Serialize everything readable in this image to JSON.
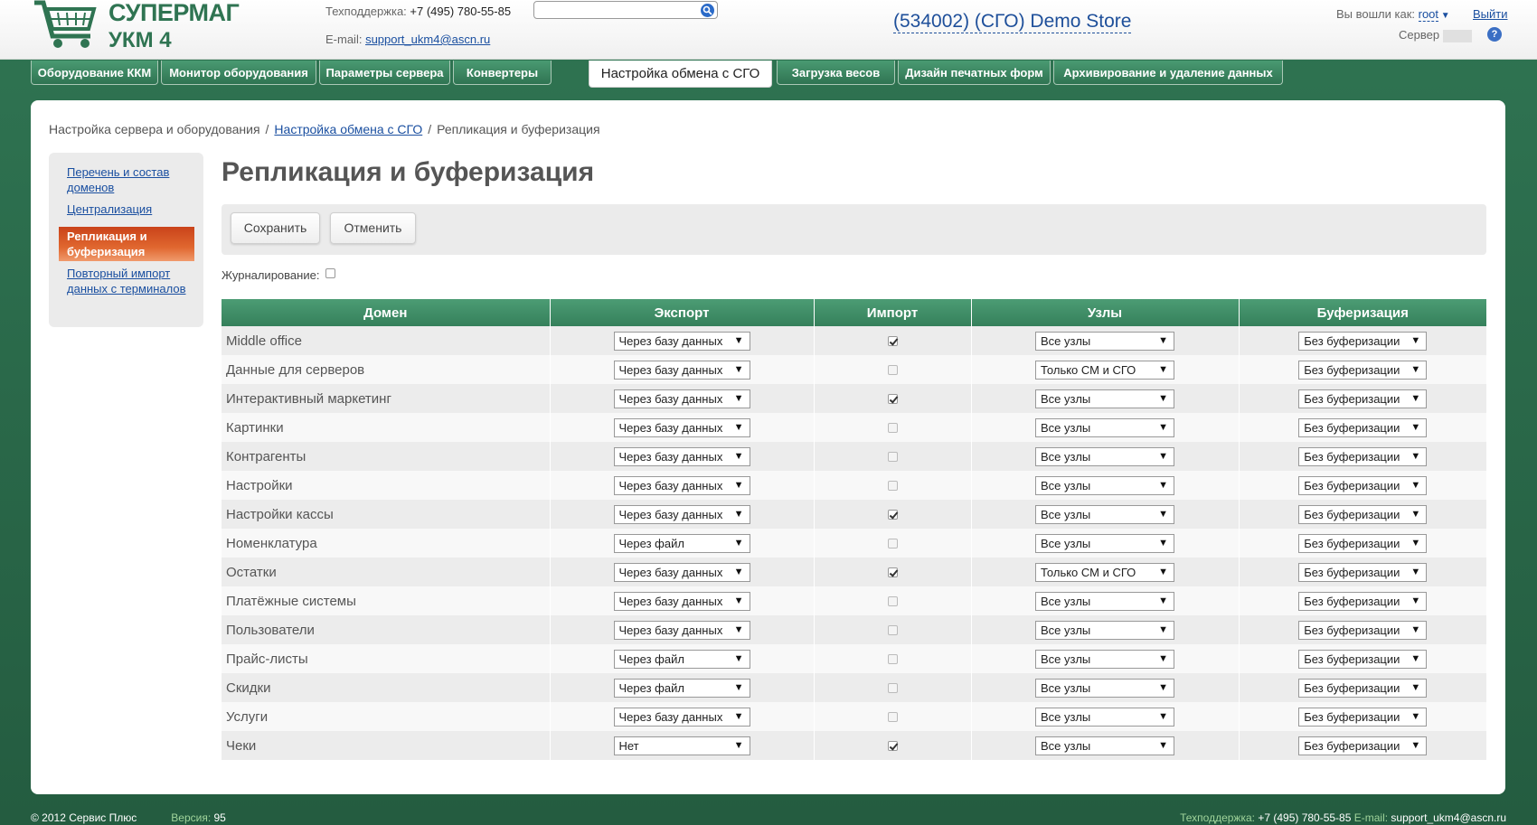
{
  "header": {
    "logo_line1": "СУПЕРМАГ",
    "logo_line2": "УКМ 4",
    "support_label": "Техподдержка: ",
    "support_phone": "+7 (495) 780-55-85",
    "email_label": "E-mail: ",
    "email": "support_ukm4@ascn.ru",
    "search_placeholder": "",
    "store_name": "(534002) (СГО) Demo Store",
    "logged_in_label": "Вы вошли как: ",
    "username": "root",
    "logout_label": "Выйти",
    "server_label": "Сервер",
    "help_glyph": "?"
  },
  "tabs": [
    {
      "label": "Оборудование ККМ"
    },
    {
      "label": "Монитор оборудования"
    },
    {
      "label": "Параметры сервера"
    },
    {
      "label": "Конвертеры"
    },
    {
      "label": "Настройка обмена с СГО",
      "active": true
    },
    {
      "label": "Загрузка весов"
    },
    {
      "label": "Дизайн печатных форм"
    },
    {
      "label": "Архивирование и удаление данных"
    }
  ],
  "breadcrumb": {
    "item1": "Настройка сервера и оборудования",
    "item2": "Настройка обмена с СГО",
    "item3": "Репликация и буферизация",
    "separator": "/"
  },
  "sidebar": {
    "items": [
      {
        "label": "Перечень и состав доменов"
      },
      {
        "label": "Централизация"
      },
      {
        "label": "Репликация и буферизация",
        "active": true
      },
      {
        "label": "Повторный импорт данных с терминалов"
      }
    ]
  },
  "page": {
    "title": "Репликация и буферизация",
    "save_label": "Сохранить",
    "cancel_label": "Отменить",
    "journal_label": "Журналирование:",
    "journal_checked": false
  },
  "table": {
    "headers": {
      "domain": "Домен",
      "export": "Экспорт",
      "import": "Импорт",
      "nodes": "Узлы",
      "buffer": "Буферизация"
    },
    "rows": [
      {
        "domain": "Middle office",
        "export": "Через базу данных",
        "import": true,
        "nodes": "Все узлы",
        "buffer": "Без буферизации"
      },
      {
        "domain": "Данные для серверов",
        "export": "Через базу данных",
        "import": false,
        "nodes": "Только СМ и СГО",
        "buffer": "Без буферизации"
      },
      {
        "domain": "Интерактивный маркетинг",
        "export": "Через базу данных",
        "import": true,
        "nodes": "Все узлы",
        "buffer": "Без буферизации"
      },
      {
        "domain": "Картинки",
        "export": "Через базу данных",
        "import": false,
        "nodes": "Все узлы",
        "buffer": "Без буферизации"
      },
      {
        "domain": "Контрагенты",
        "export": "Через базу данных",
        "import": false,
        "nodes": "Все узлы",
        "buffer": "Без буферизации"
      },
      {
        "domain": "Настройки",
        "export": "Через базу данных",
        "import": false,
        "nodes": "Все узлы",
        "buffer": "Без буферизации"
      },
      {
        "domain": "Настройки кассы",
        "export": "Через базу данных",
        "import": true,
        "nodes": "Все узлы",
        "buffer": "Без буферизации"
      },
      {
        "domain": "Номенклатура",
        "export": "Через файл",
        "import": false,
        "nodes": "Все узлы",
        "buffer": "Без буферизации"
      },
      {
        "domain": "Остатки",
        "export": "Через базу данных",
        "import": true,
        "nodes": "Только СМ и СГО",
        "buffer": "Без буферизации"
      },
      {
        "domain": "Платёжные системы",
        "export": "Через базу данных",
        "import": false,
        "nodes": "Все узлы",
        "buffer": "Без буферизации"
      },
      {
        "domain": "Пользователи",
        "export": "Через базу данных",
        "import": false,
        "nodes": "Все узлы",
        "buffer": "Без буферизации"
      },
      {
        "domain": "Прайс-листы",
        "export": "Через файл",
        "import": false,
        "nodes": "Все узлы",
        "buffer": "Без буферизации"
      },
      {
        "domain": "Скидки",
        "export": "Через файл",
        "import": false,
        "nodes": "Все узлы",
        "buffer": "Без буферизации"
      },
      {
        "domain": "Услуги",
        "export": "Через базу данных",
        "import": false,
        "nodes": "Все узлы",
        "buffer": "Без буферизации"
      },
      {
        "domain": "Чеки",
        "export": "Нет",
        "import": true,
        "nodes": "Все узлы",
        "buffer": "Без буферизации"
      }
    ]
  },
  "footer": {
    "copyright": "© 2012 Сервис Плюс",
    "version_label": "Версия: ",
    "version": "95",
    "support_label": "Техподдержка: ",
    "support_phone": "+7 (495) 780-55-85",
    "email_label": " E-mail: ",
    "email": "support_ukm4@ascn.ru"
  },
  "colors": {
    "brand_green": "#2f7452",
    "active_menu": "#d9541f",
    "link": "#1a4fa0"
  }
}
